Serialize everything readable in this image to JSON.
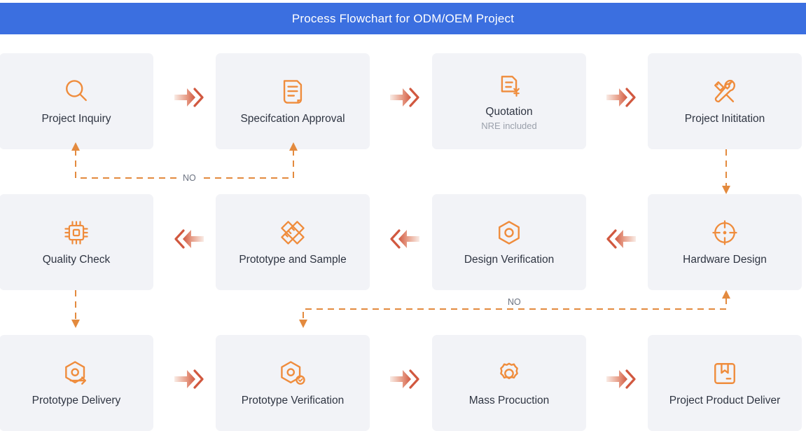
{
  "header": {
    "title": "Process Flowchart for ODM/OEM Project",
    "background_color": "#3b6fe0",
    "text_color": "#ffffff"
  },
  "theme": {
    "node_background": "#f2f3f7",
    "icon_color": "#ef8c3c",
    "label_color": "#2f3542",
    "sublabel_color": "#9aa0ab",
    "connector_color": "#e38a3e",
    "arrow_gradient_from": "#f7e3da",
    "arrow_gradient_to": "#d8604a"
  },
  "rows": [
    {
      "direction": "left-to-right",
      "nodes": [
        {
          "label": "Project Inquiry",
          "sublabel": "",
          "icon": "magnifier-icon"
        },
        {
          "label": "Specifcation Approval",
          "sublabel": "",
          "icon": "document-lines-icon"
        },
        {
          "label": "Quotation",
          "sublabel": "NRE included",
          "icon": "invoice-yen-icon"
        },
        {
          "label": "Project Inititation",
          "sublabel": "",
          "icon": "wrench-screwdriver-icon"
        }
      ]
    },
    {
      "direction": "right-to-left",
      "nodes": [
        {
          "label": "Quality Check",
          "sublabel": "",
          "icon": "microchip-icon"
        },
        {
          "label": "Prototype and Sample",
          "sublabel": "",
          "icon": "ruler-pencil-icon"
        },
        {
          "label": "Design Verification",
          "sublabel": "",
          "icon": "hexagon-circle-icon"
        },
        {
          "label": "Hardware Design",
          "sublabel": "",
          "icon": "crosshair-icon"
        }
      ]
    },
    {
      "direction": "left-to-right",
      "nodes": [
        {
          "label": "Prototype Delivery",
          "sublabel": "",
          "icon": "hexagon-arrow-icon"
        },
        {
          "label": "Prototype Verification",
          "sublabel": "",
          "icon": "hexagon-check-icon"
        },
        {
          "label": "Mass Procuction",
          "sublabel": "",
          "icon": "gear-icon"
        },
        {
          "label": "Project Product Deliver",
          "sublabel": "",
          "icon": "package-box-icon"
        }
      ]
    }
  ],
  "feedback_loops": [
    {
      "label": "NO",
      "from": "Specifcation Approval",
      "to": "Project Inquiry"
    },
    {
      "label": "NO",
      "from": "Hardware Design",
      "to": "Prototype Verification"
    }
  ],
  "vertical_links": [
    {
      "from": "Project Inititation",
      "to": "Hardware Design"
    },
    {
      "from": "Quality Check",
      "to": "Prototype Delivery"
    }
  ]
}
